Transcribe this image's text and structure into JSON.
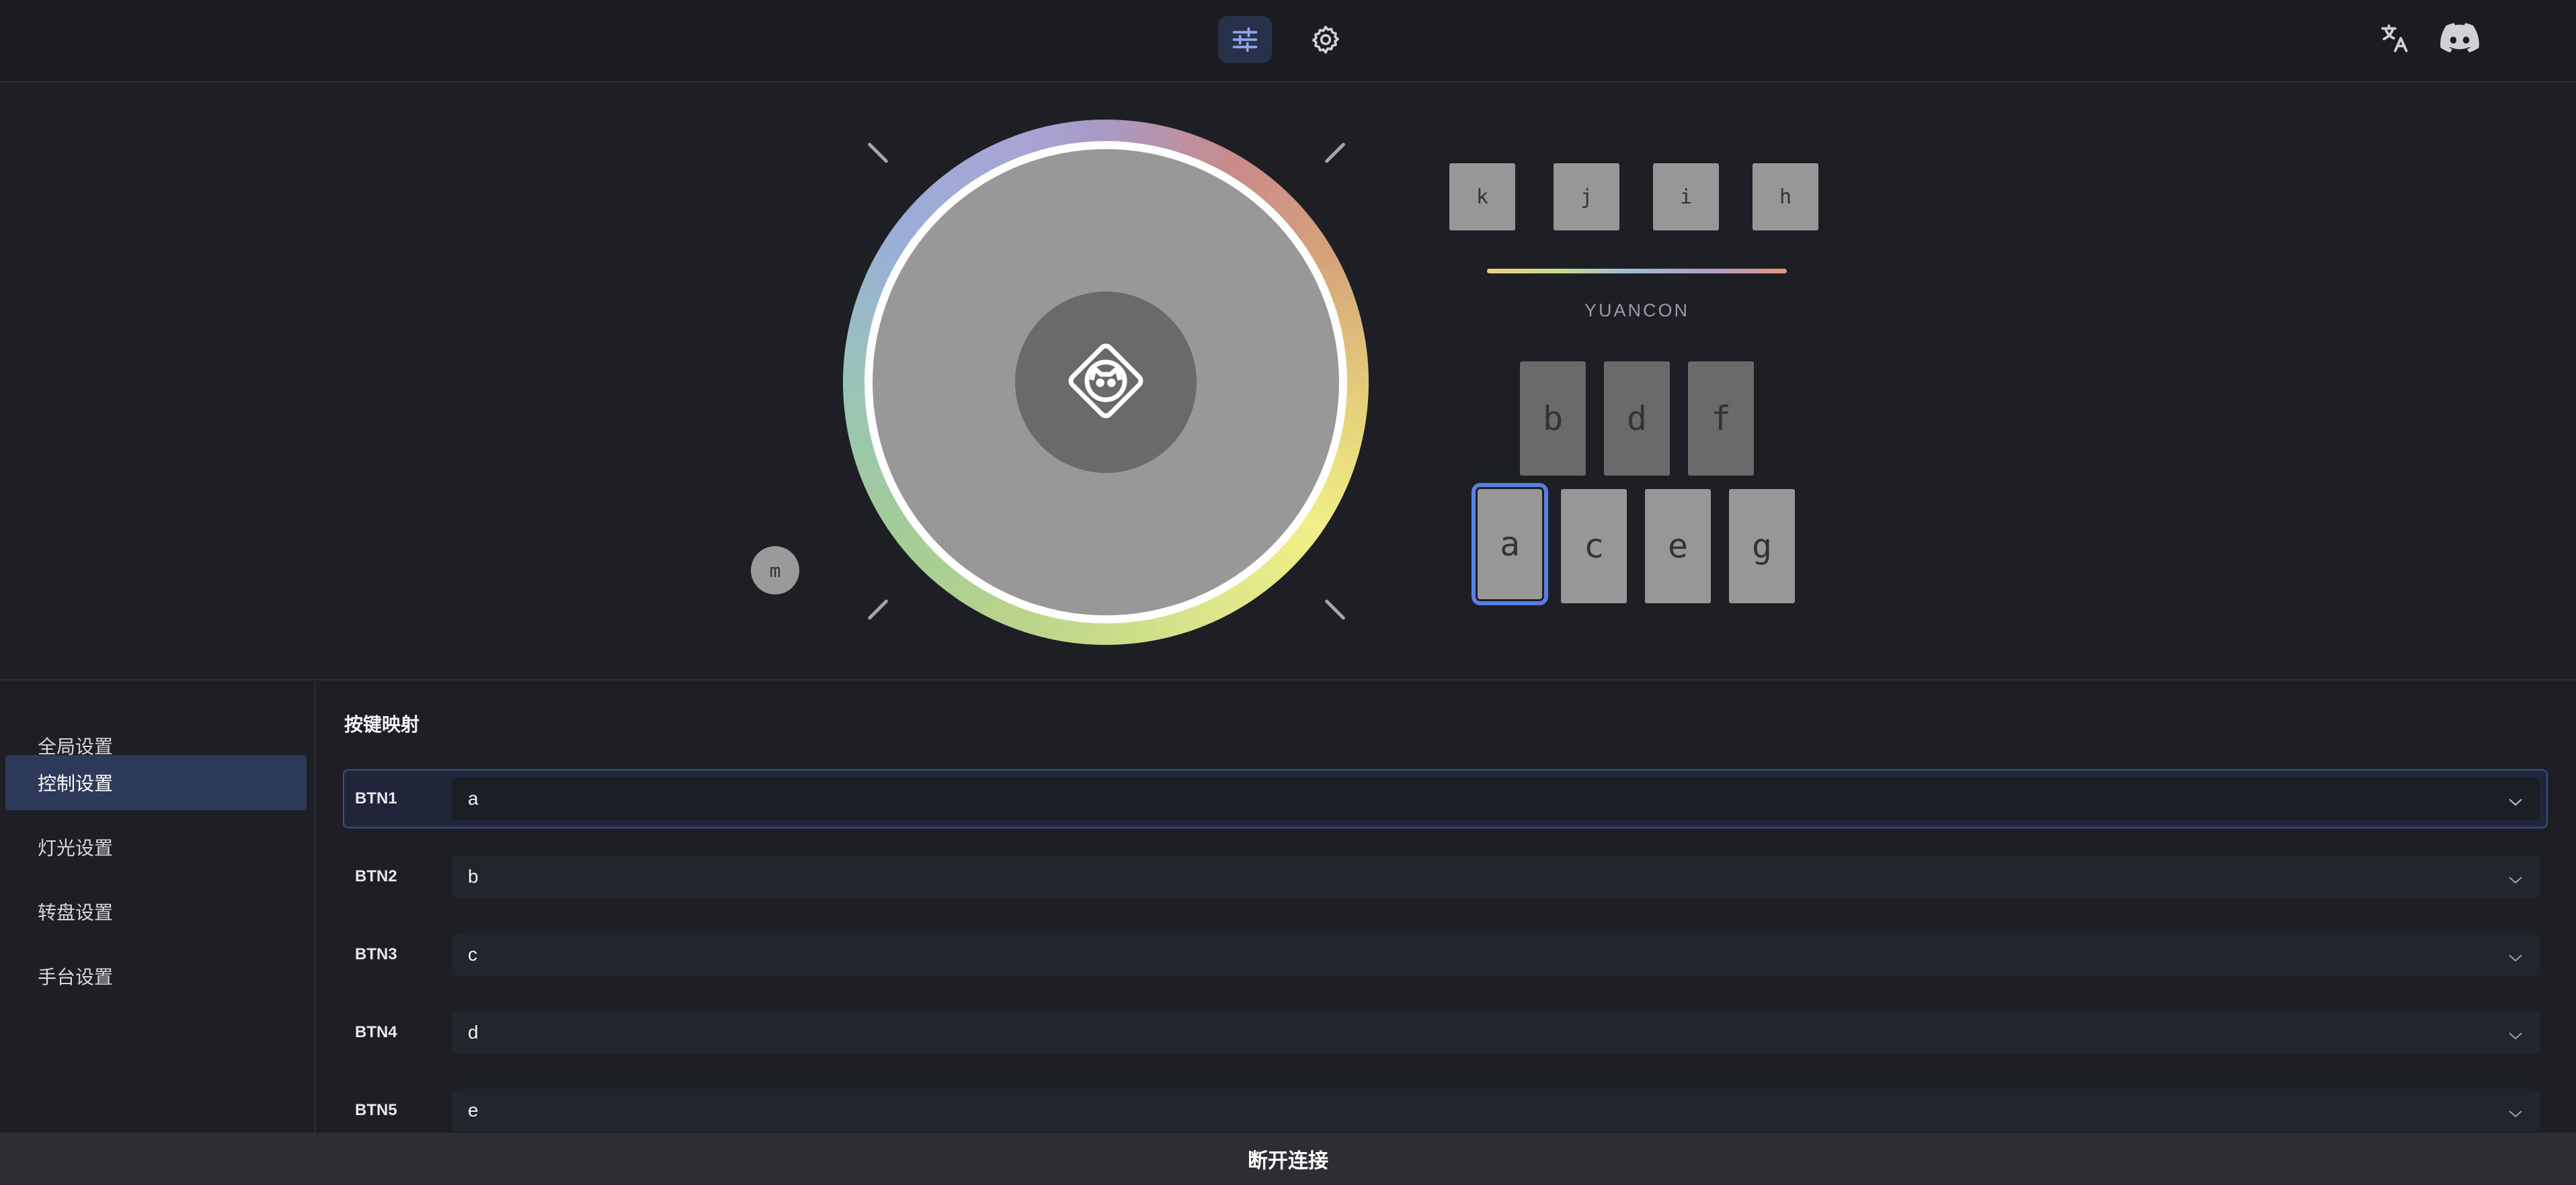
{
  "topbar": {
    "icons": {
      "tuning": "sliders-icon",
      "settings": "gear-icon",
      "language": "translate-icon",
      "community": "discord-icon"
    }
  },
  "preview": {
    "m_label": "m",
    "top_keys": [
      "k",
      "j",
      "i",
      "h"
    ],
    "brand": "YUANCON",
    "upper_keys": [
      "b",
      "d",
      "f"
    ],
    "lower_keys": [
      "a",
      "c",
      "e",
      "g"
    ],
    "logo_icon": "cat-diamond-logo-icon"
  },
  "sidebar": {
    "items": [
      {
        "label": "全局设置"
      },
      {
        "label": "控制设置"
      },
      {
        "label": "灯光设置"
      },
      {
        "label": "转盘设置"
      },
      {
        "label": "手台设置"
      }
    ],
    "active_index": 1
  },
  "main": {
    "title": "按键映射",
    "mappings": [
      {
        "label": "BTN1",
        "value": "a"
      },
      {
        "label": "BTN2",
        "value": "b"
      },
      {
        "label": "BTN3",
        "value": "c"
      },
      {
        "label": "BTN4",
        "value": "d"
      },
      {
        "label": "BTN5",
        "value": "e"
      }
    ]
  },
  "footer": {
    "disconnect_label": "断开连接"
  },
  "colors": {
    "accent": "#5b7fe8",
    "active_bg": "#2e3a5a",
    "background": "#1e1f25"
  }
}
